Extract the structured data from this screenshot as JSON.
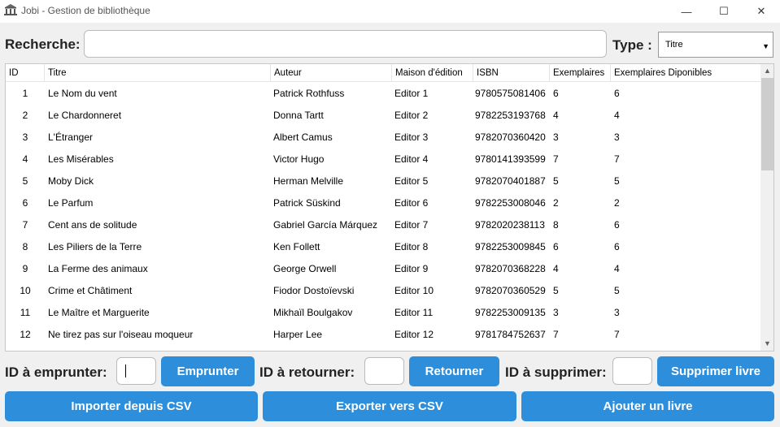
{
  "window": {
    "title": "Jobi - Gestion de bibliothèque",
    "minimize_glyph": "—",
    "maximize_glyph": "☐",
    "close_glyph": "✕"
  },
  "search": {
    "label": "Recherche:",
    "value": "",
    "type_label": "Type :",
    "type_selected": "Titre"
  },
  "table": {
    "columns": [
      "ID",
      "Titre",
      "Auteur",
      "Maison d'édition",
      "ISBN",
      "Exemplaires",
      "Exemplaires Diponibles"
    ],
    "rows": [
      {
        "id": "1",
        "titre": "Le Nom du vent",
        "auteur": "Patrick Rothfuss",
        "editeur": "Editor 1",
        "isbn": "9780575081406",
        "ex": "6",
        "exd": "6"
      },
      {
        "id": "2",
        "titre": "Le Chardonneret",
        "auteur": "Donna Tartt",
        "editeur": "Editor 2",
        "isbn": "9782253193768",
        "ex": "4",
        "exd": "4"
      },
      {
        "id": "3",
        "titre": "L'Étranger",
        "auteur": "Albert Camus",
        "editeur": "Editor 3",
        "isbn": "9782070360420",
        "ex": "3",
        "exd": "3"
      },
      {
        "id": "4",
        "titre": "Les Misérables",
        "auteur": "Victor Hugo",
        "editeur": "Editor 4",
        "isbn": "9780141393599",
        "ex": "7",
        "exd": "7"
      },
      {
        "id": "5",
        "titre": "Moby Dick",
        "auteur": "Herman Melville",
        "editeur": "Editor 5",
        "isbn": "9782070401887",
        "ex": "5",
        "exd": "5"
      },
      {
        "id": "6",
        "titre": "Le Parfum",
        "auteur": "Patrick Süskind",
        "editeur": "Editor 6",
        "isbn": "9782253008046",
        "ex": "2",
        "exd": "2"
      },
      {
        "id": "7",
        "titre": "Cent ans de solitude",
        "auteur": "Gabriel García Márquez",
        "editeur": "Editor 7",
        "isbn": "9782020238113",
        "ex": "8",
        "exd": "6"
      },
      {
        "id": "8",
        "titre": "Les Piliers de la Terre",
        "auteur": "Ken Follett",
        "editeur": "Editor 8",
        "isbn": "9782253009845",
        "ex": "6",
        "exd": "6"
      },
      {
        "id": "9",
        "titre": "La Ferme des animaux",
        "auteur": "George Orwell",
        "editeur": "Editor 9",
        "isbn": "9782070368228",
        "ex": "4",
        "exd": "4"
      },
      {
        "id": "10",
        "titre": "Crime et Châtiment",
        "auteur": "Fiodor Dostoïevski",
        "editeur": "Editor 10",
        "isbn": "9782070360529",
        "ex": "5",
        "exd": "5"
      },
      {
        "id": "11",
        "titre": "Le Maître et Marguerite",
        "auteur": "Mikhaïl Boulgakov",
        "editeur": "Editor 11",
        "isbn": "9782253009135",
        "ex": "3",
        "exd": "3"
      },
      {
        "id": "12",
        "titre": "Ne tirez pas sur l'oiseau moqueur",
        "auteur": "Harper Lee",
        "editeur": "Editor 12",
        "isbn": "9781784752637",
        "ex": "7",
        "exd": "7"
      }
    ]
  },
  "actions": {
    "borrow_label": "ID à emprunter:",
    "borrow_value": "",
    "borrow_button": "Emprunter",
    "return_label": "ID à retourner:",
    "return_value": "",
    "return_button": "Retourner",
    "delete_label": "ID à supprimer:",
    "delete_value": "",
    "delete_button": "Supprimer livre"
  },
  "bottom": {
    "import_button": "Importer depuis CSV",
    "export_button": "Exporter vers CSV",
    "add_button": "Ajouter un livre"
  },
  "colors": {
    "accent": "#2d8fdc",
    "background": "#f0f0f0"
  }
}
